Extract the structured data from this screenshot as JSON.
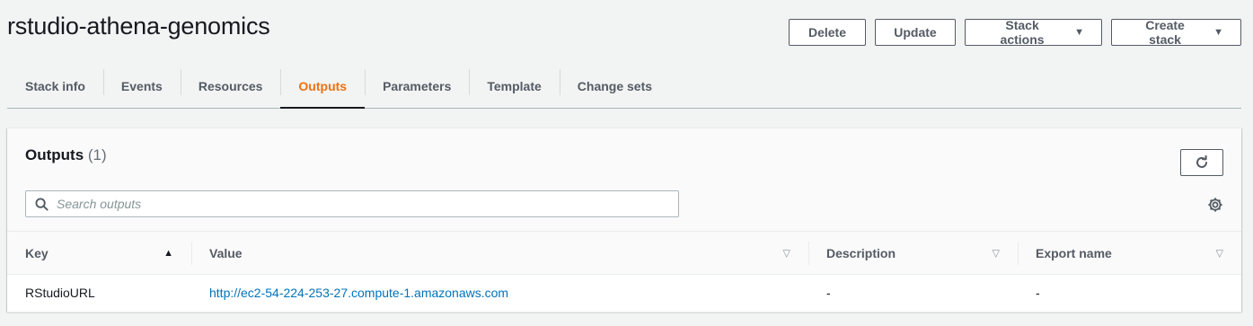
{
  "header": {
    "title": "rstudio-athena-genomics",
    "buttons": {
      "delete": "Delete",
      "update": "Update",
      "stack_actions": "Stack actions",
      "create_stack": "Create stack"
    }
  },
  "tabs": [
    {
      "label": "Stack info"
    },
    {
      "label": "Events"
    },
    {
      "label": "Resources"
    },
    {
      "label": "Outputs",
      "active": true
    },
    {
      "label": "Parameters"
    },
    {
      "label": "Template"
    },
    {
      "label": "Change sets"
    }
  ],
  "outputs": {
    "title": "Outputs",
    "count": "(1)",
    "search_placeholder": "Search outputs",
    "columns": {
      "key": "Key",
      "value": "Value",
      "description": "Description",
      "export_name": "Export name"
    },
    "rows": [
      {
        "key": "RStudioURL",
        "value": "http://ec2-54-224-253-27.compute-1.amazonaws.com",
        "description": "-",
        "export_name": "-"
      }
    ]
  },
  "icons": {
    "search": "search-icon",
    "refresh": "refresh-icon",
    "settings": "gear-icon",
    "sort_asc": "sort-ascending-icon",
    "sort_none": "sort-indicator-icon",
    "dropdown": "caret-down-icon"
  },
  "colors": {
    "active_tab": "#ec7211",
    "link": "#0073bb",
    "background": "#f2f3f3"
  }
}
